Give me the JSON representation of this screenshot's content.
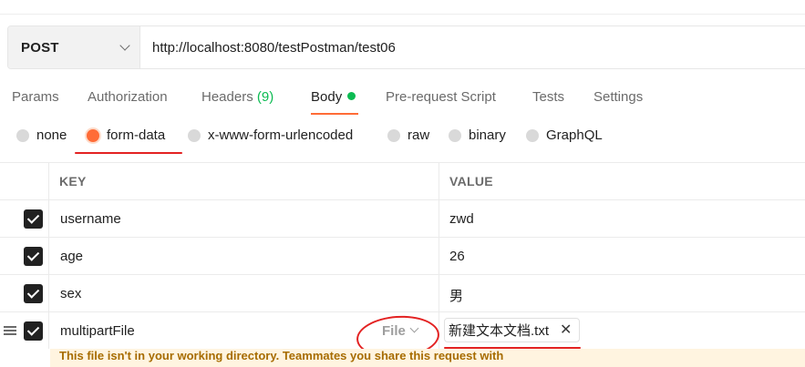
{
  "request": {
    "method": "POST",
    "url": "http://localhost:8080/testPostman/test06"
  },
  "tabs": [
    {
      "label": "Params"
    },
    {
      "label": "Authorization"
    },
    {
      "label": "Headers",
      "count": "(9)"
    },
    {
      "label": "Body"
    },
    {
      "label": "Pre-request Script"
    },
    {
      "label": "Tests"
    },
    {
      "label": "Settings"
    }
  ],
  "body_types": [
    {
      "label": "none",
      "selected": false
    },
    {
      "label": "form-data",
      "selected": true
    },
    {
      "label": "x-www-form-urlencoded",
      "selected": false
    },
    {
      "label": "raw",
      "selected": false
    },
    {
      "label": "binary",
      "selected": false
    },
    {
      "label": "GraphQL",
      "selected": false
    }
  ],
  "table": {
    "headers": {
      "key": "KEY",
      "value": "VALUE"
    },
    "rows": [
      {
        "key": "username",
        "value": "zwd",
        "checked": true
      },
      {
        "key": "age",
        "value": "26",
        "checked": true
      },
      {
        "key": "sex",
        "value": "男",
        "checked": true
      },
      {
        "key": "multipartFile",
        "type": "File",
        "file_name": "新建文本文档.txt",
        "checked": true
      }
    ]
  },
  "warning": "This file isn't in your working directory. Teammates you share this request with",
  "colors": {
    "accent": "#ff6c37",
    "success": "#0cbb52",
    "annotation": "#e32222"
  }
}
